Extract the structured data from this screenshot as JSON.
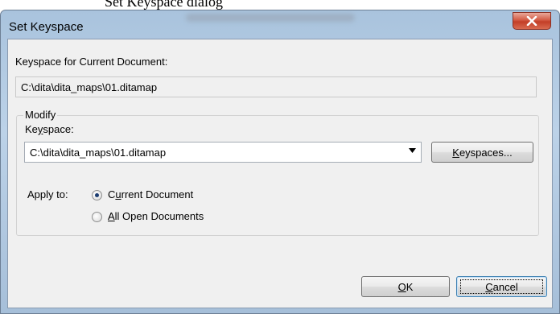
{
  "background_text": "Set Keyspace dialog",
  "dialog": {
    "title": "Set Keyspace",
    "close_icon": "close-icon"
  },
  "current": {
    "label": "Keyspace for Current Document:",
    "value": "C:\\dita\\dita_maps\\01.ditamap"
  },
  "modify": {
    "group_title": "Modify",
    "keyspace_label_pre": "Ke",
    "keyspace_label_mnemonic": "y",
    "keyspace_label_post": "space:",
    "keyspace_value": "C:\\dita\\dita_maps\\01.ditamap",
    "keyspaces_button_mnemonic": "K",
    "keyspaces_button_rest": "eyspaces...",
    "apply_to_label": "Apply to:",
    "options": [
      {
        "pre": "C",
        "mnemonic": "u",
        "post": "rrent Document",
        "checked": true
      },
      {
        "pre": "",
        "mnemonic": "A",
        "post": "ll Open Documents",
        "checked": false
      }
    ]
  },
  "buttons": {
    "ok_mnemonic": "O",
    "ok_rest": "K",
    "cancel_mnemonic": "C",
    "cancel_rest": "ancel"
  }
}
